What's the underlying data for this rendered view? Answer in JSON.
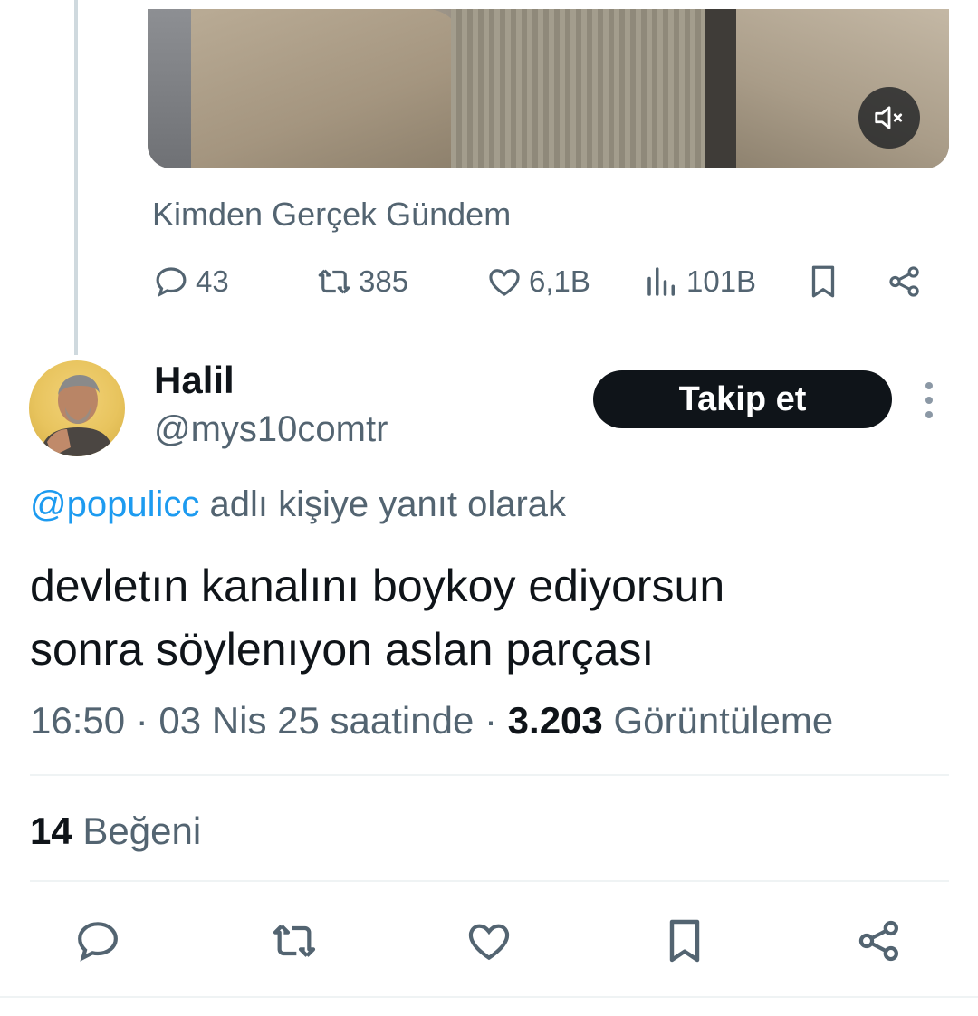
{
  "parent_tweet": {
    "source_label": "Kimden Gerçek Gündem",
    "stats": {
      "replies": "43",
      "retweets": "385",
      "likes": "6,1B",
      "views": "101B"
    },
    "media": {
      "muted_icon": "speaker-muted-icon"
    }
  },
  "reply_tweet": {
    "display_name": "Halil",
    "handle": "@mys10comtr",
    "follow_label": "Takip et",
    "reply_mention": "@populicc",
    "reply_suffix": "adlı kişiye yanıt olarak",
    "text_line1": "devletın kanalını boykoy ediyorsun",
    "text_line2": "sonra söylenıyon aslan parçası",
    "time": "16:50",
    "date_suffix": "· 03 Nis 25 saatinde ·",
    "views_count": "3.203",
    "views_label": "Görüntüleme",
    "likes_count": "14",
    "likes_label": "Beğeni"
  },
  "colors": {
    "accent": "#1d9bf0",
    "secondary_text": "#536471",
    "primary_text": "#0f1419"
  }
}
